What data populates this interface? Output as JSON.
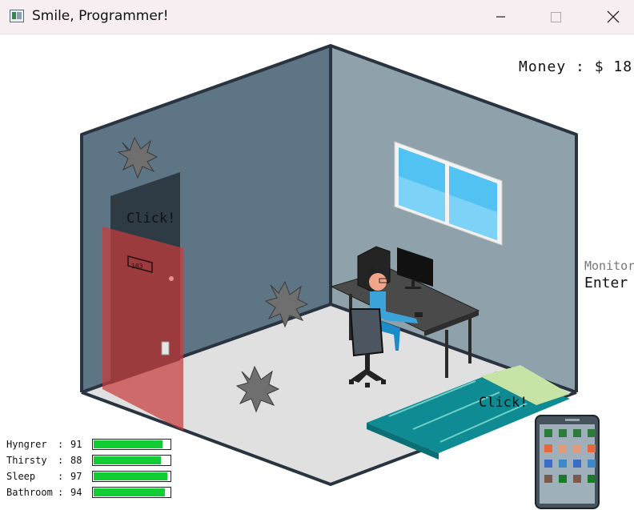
{
  "window": {
    "title": "Smile, Programmer!",
    "icon": "app-window-icon",
    "controls": [
      "minimize-icon",
      "maximize-icon",
      "close-icon"
    ]
  },
  "hud": {
    "money_label": "Money : $ 18",
    "monitor_label": "Monitor",
    "enter_label": "Enter"
  },
  "room": {
    "door_click_label": "Click!",
    "bed_click_label": "Click!",
    "door_number": "103",
    "colors": {
      "left_wall": "#5d7585",
      "right_wall": "#8fa2ab",
      "floor": "#e0e0e0",
      "door_overlay": "#c83c3c",
      "window_glass": "#52c2f3",
      "bed_blanket": "#0f8b94",
      "bed_pillow": "#c8e3a6"
    }
  },
  "stats": [
    {
      "label": "Hyngrer",
      "value": "91",
      "fill": 0.91
    },
    {
      "label": "Thirsty",
      "value": "88",
      "fill": 0.88
    },
    {
      "label": "Sleep",
      "value": "97",
      "fill": 0.97
    },
    {
      "label": "Bathroom",
      "value": "94",
      "fill": 0.94
    }
  ],
  "phone": {
    "icon": "phone-icon",
    "app_colors": [
      [
        "#2e7a3c",
        "#2e7a3c",
        "#2e7a3c",
        "#2e7a3c"
      ],
      [
        "#e8673c",
        "#e09a7a",
        "#e09a7a",
        "#e8673c"
      ],
      [
        "#3a6cc8",
        "#3a8ac8",
        "#3a6cc8",
        "#3a8ac8"
      ],
      [
        "#7a5a4a",
        "#1a7a2a",
        "#7a5a4a",
        "#1a7a2a"
      ]
    ]
  }
}
